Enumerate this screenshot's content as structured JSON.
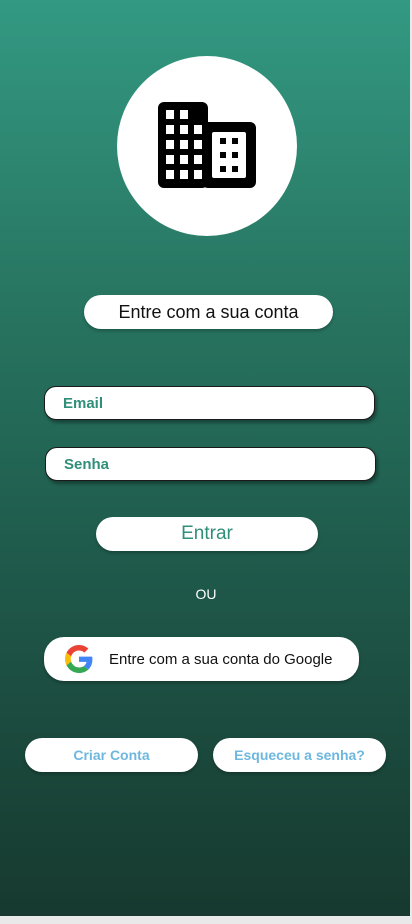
{
  "logo": {
    "icon": "building-icon"
  },
  "title": "Entre com a sua conta",
  "form": {
    "email_placeholder": "Email",
    "senha_placeholder": "Senha",
    "submit_label": "Entrar"
  },
  "divider_text": "OU",
  "google": {
    "icon": "google-icon",
    "label": "Entre com a sua conta do Google"
  },
  "links": {
    "create_account": "Criar Conta",
    "forgot_password": "Esqueceu a senha?"
  },
  "colors": {
    "background_top": "#339982",
    "background_bottom": "#17392f",
    "accent_green": "#2f8f79",
    "link_blue": "#6eb7de"
  }
}
